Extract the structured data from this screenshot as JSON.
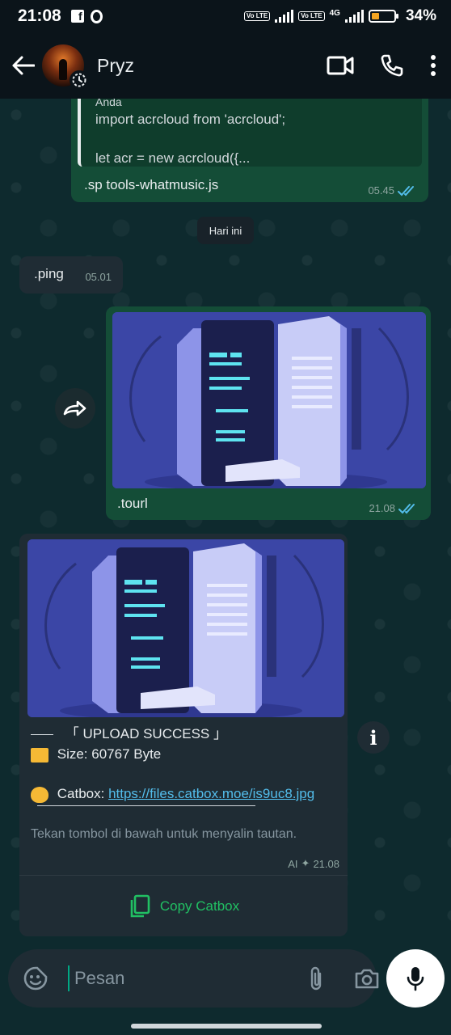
{
  "status_bar": {
    "time": "21:08",
    "left_icons": [
      "facebook-icon",
      "opera-icon"
    ],
    "sim1_label": "Vo LTE",
    "sim2_label": "Vo LTE",
    "network": "4G",
    "battery_percent": "34%",
    "battery_level": 0.34,
    "battery_color": "#f5a623"
  },
  "header": {
    "contact_name": "Pryz"
  },
  "messages": {
    "quoted": {
      "author": "Anda",
      "line1": "import acrcloud from 'acrcloud';",
      "line2": "let acr = new acrcloud({..."
    },
    "msg1": {
      "text": ".sp tools-whatmusic.js",
      "time": "05.45"
    },
    "date_separator": "Hari ini",
    "msg2": {
      "text": ".ping",
      "time": "05.01"
    },
    "msg3": {
      "text": ".tourl",
      "time": "21.08"
    },
    "msg4": {
      "title": "「 UPLOAD SUCCESS 」",
      "size_label": "Size: 60767 Byte",
      "catbox_label": "Catbox:",
      "catbox_link": "https://files.catbox.moe/is9uc8.jpg",
      "hint": "Tekan tombol di bawah untuk menyalin tautan.",
      "ai_label": "AI",
      "time": "21.08",
      "copy_button": "Copy Catbox"
    }
  },
  "input": {
    "placeholder": "Pesan"
  },
  "colors": {
    "accent": "#00a884",
    "outgoing_bubble": "#144d37",
    "incoming_bubble": "#1f2c34",
    "link": "#53bdeb",
    "read_ticks": "#53bdeb"
  }
}
